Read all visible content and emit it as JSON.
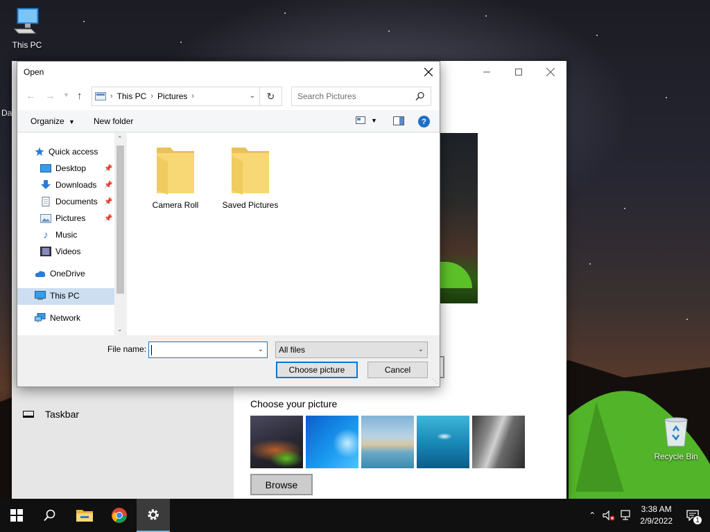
{
  "desktop": {
    "icons": [
      {
        "label": "This PC"
      },
      {
        "label": "Recycle Bin"
      }
    ],
    "partial_label": "Da"
  },
  "settings": {
    "nav_item": "Taskbar",
    "choose_picture_label": "Choose your picture",
    "browse_label": "Browse",
    "thumbnails": [
      "thumb-night-sky",
      "thumb-windows-blue",
      "thumb-beach",
      "thumb-underwater",
      "thumb-rock"
    ]
  },
  "dialog": {
    "title": "Open",
    "address": {
      "segments": [
        "This PC",
        "Pictures"
      ]
    },
    "search_placeholder": "Search Pictures",
    "toolbar": {
      "organize": "Organize",
      "new_folder": "New folder",
      "help": "?"
    },
    "nav": {
      "quick_access": "Quick access",
      "items": [
        {
          "label": "Desktop",
          "pinned": true
        },
        {
          "label": "Downloads",
          "pinned": true
        },
        {
          "label": "Documents",
          "pinned": true
        },
        {
          "label": "Pictures",
          "pinned": true
        },
        {
          "label": "Music",
          "pinned": false
        },
        {
          "label": "Videos",
          "pinned": false
        }
      ],
      "onedrive": "OneDrive",
      "this_pc": "This PC",
      "network": "Network"
    },
    "folders": [
      "Camera Roll",
      "Saved Pictures"
    ],
    "file_name_label": "File name:",
    "file_name_value": "",
    "file_type": "All files",
    "choose_button": "Choose picture",
    "cancel_button": "Cancel"
  },
  "taskbar": {
    "time": "3:38 AM",
    "date": "2/9/2022",
    "notification_count": "1",
    "accent": "#76b9ed"
  }
}
